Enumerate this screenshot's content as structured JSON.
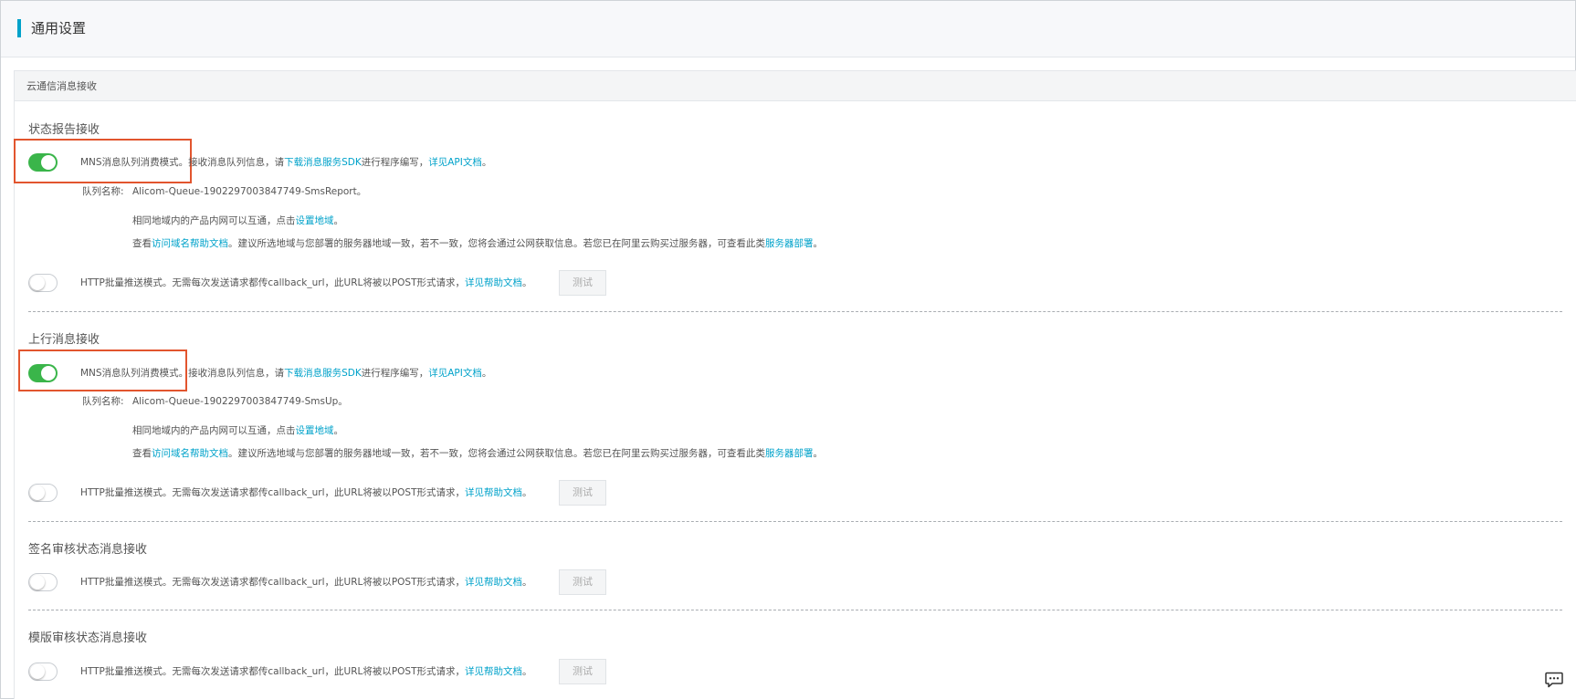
{
  "page": {
    "title": "通用设置"
  },
  "panel": {
    "title": "云通信消息接收"
  },
  "sections": {
    "status": {
      "title": "状态报告接收",
      "mns": {
        "pre": "MNS消息队列消费模式。接收消息队列信息，请",
        "sdk_link": "下载消息服务SDK",
        "mid": "进行程序编写，",
        "api_link": "详见API文档",
        "post": "。",
        "toggle_on": true
      },
      "queue": {
        "label": "队列名称:",
        "value": "Alicom-Queue-1902297003847749-SmsReport。"
      },
      "region": {
        "pre": "相同地域内的产品内网可以互通，点击",
        "link": "设置地域",
        "post": "。"
      },
      "help": {
        "pre": "查看",
        "link1": "访问域名帮助文档",
        "mid": "。建议所选地域与您部署的服务器地域一致，若不一致，您将会通过公网获取信息。若您已在阿里云购买过服务器，可查看此类",
        "link2": "服务器部署",
        "post": "。"
      },
      "http": {
        "text": "HTTP批量推送模式。无需每次发送请求都传callback_url，此URL将被以POST形式请求，",
        "link": "详见帮助文档",
        "post": "。",
        "button": "测试",
        "toggle_on": false
      }
    },
    "upstream": {
      "title": "上行消息接收",
      "mns": {
        "pre": "MNS消息队列消费模式。接收消息队列信息，请",
        "sdk_link": "下载消息服务SDK",
        "mid": "进行程序编写，",
        "api_link": "详见API文档",
        "post": "。",
        "toggle_on": true
      },
      "queue": {
        "label": "队列名称:",
        "value": "Alicom-Queue-1902297003847749-SmsUp。"
      },
      "region": {
        "pre": "相同地域内的产品内网可以互通，点击",
        "link": "设置地域",
        "post": "。"
      },
      "help": {
        "pre": "查看",
        "link1": "访问域名帮助文档",
        "mid": "。建议所选地域与您部署的服务器地域一致，若不一致，您将会通过公网获取信息。若您已在阿里云购买过服务器，可查看此类",
        "link2": "服务器部署",
        "post": "。"
      },
      "http": {
        "text": "HTTP批量推送模式。无需每次发送请求都传callback_url，此URL将被以POST形式请求，",
        "link": "详见帮助文档",
        "post": "。",
        "button": "测试",
        "toggle_on": false
      }
    },
    "signature": {
      "title": "签名审核状态消息接收",
      "http": {
        "text": "HTTP批量推送模式。无需每次发送请求都传callback_url，此URL将被以POST形式请求，",
        "link": "详见帮助文档",
        "post": "。",
        "button": "测试",
        "toggle_on": false
      }
    },
    "template": {
      "title": "模版审核状态消息接收",
      "http": {
        "text": "HTTP批量推送模式。无需每次发送请求都传callback_url，此URL将被以POST形式请求，",
        "link": "详见帮助文档",
        "post": "。",
        "button": "测试",
        "toggle_on": false
      }
    }
  },
  "colors": {
    "accent": "#00a2ca",
    "toggle_on": "#3ab54a",
    "highlight": "#e2552e"
  },
  "icons": {
    "chat": "chat-bubble-icon"
  }
}
